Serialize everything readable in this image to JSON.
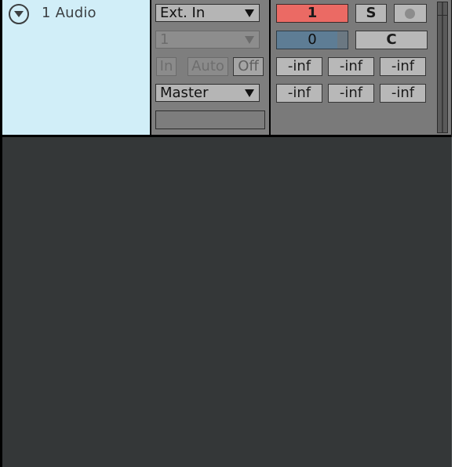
{
  "track": {
    "name": "1 Audio",
    "header_color": "#d1eef8"
  },
  "io": {
    "input_type": "Ext. In",
    "input_channel": "1",
    "monitor": {
      "in_label": "In",
      "auto_label": "Auto",
      "off_label": "Off",
      "selected": "Off"
    },
    "output_type": "Master",
    "output_channel": ""
  },
  "mixer": {
    "arm_number": "1",
    "arm_color": "#eb6a64",
    "solo_label": "S",
    "record_icon": "record-icon",
    "volume": "0",
    "volume_fraction": 0.85,
    "volume_color": "#5e7d95",
    "pan": "C",
    "meter_values": [
      [
        "-inf",
        "-inf",
        "-inf"
      ],
      [
        "-inf",
        "-inf",
        "-inf"
      ]
    ]
  },
  "icons": {
    "fold": "fold-chevron-down-icon",
    "dropdown": "dropdown-arrow-icon"
  }
}
